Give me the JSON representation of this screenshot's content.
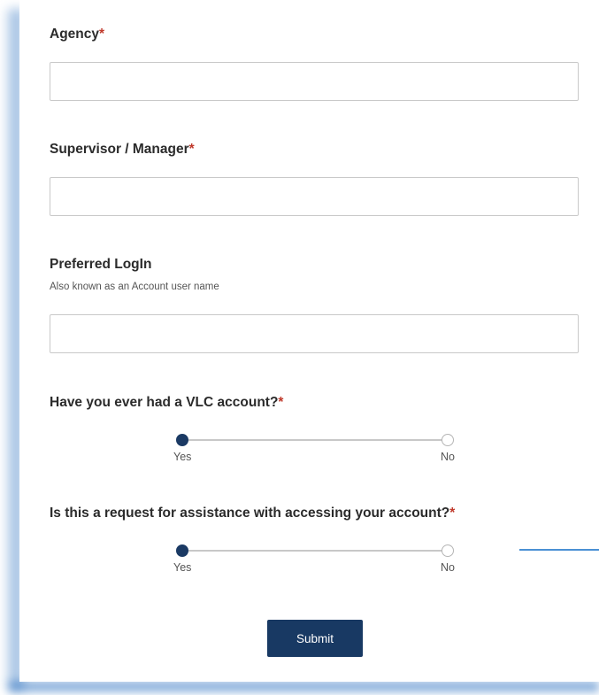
{
  "form": {
    "agency": {
      "label": "Agency",
      "required_mark": "*",
      "value": ""
    },
    "supervisor": {
      "label": "Supervisor / Manager",
      "required_mark": "*",
      "value": ""
    },
    "preferred_login": {
      "label": "Preferred LogIn",
      "hint": "Also known as an Account user name",
      "value": ""
    },
    "vlc_account": {
      "question": "Have you ever had a VLC account?",
      "required_mark": "*",
      "options": [
        "Yes",
        "No"
      ],
      "selected": "Yes"
    },
    "assistance": {
      "question": "Is this a request for assistance with accessing your account?",
      "required_mark": "*",
      "options": [
        "Yes",
        "No"
      ],
      "selected": "Yes"
    },
    "submit_label": "Submit"
  },
  "colors": {
    "accent": "#183963",
    "required": "#c0392b",
    "shadow": "#4a90d4"
  }
}
